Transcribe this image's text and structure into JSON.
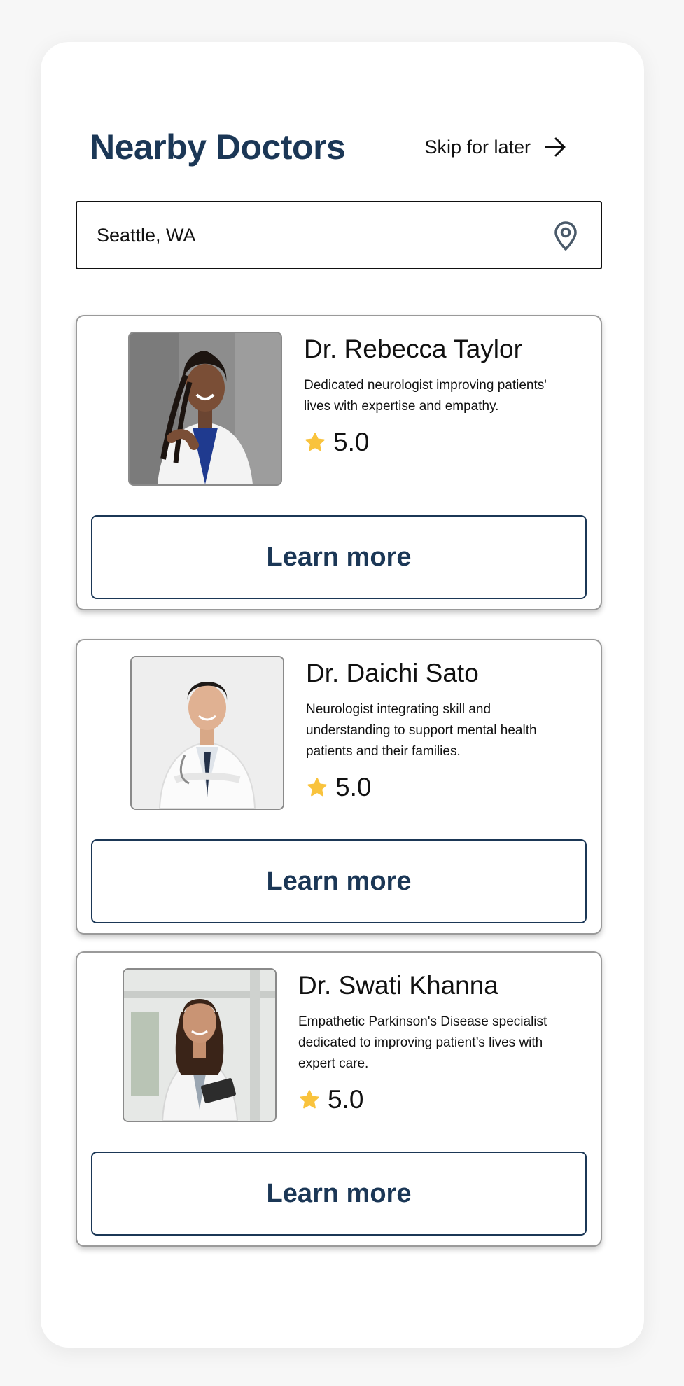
{
  "header": {
    "title": "Nearby Doctors",
    "skip_label": "Skip for later",
    "skip_icon": "arrow-right-icon"
  },
  "search": {
    "value": "Seattle, WA",
    "icon": "location-pin-icon"
  },
  "doctors": [
    {
      "name": "Dr. Rebecca Taylor",
      "description": "Dedicated neurologist improving patients' lives with expertise and empathy.",
      "rating": "5.0",
      "button_label": "Learn more"
    },
    {
      "name": "Dr. Daichi Sato",
      "description": "Neurologist integrating skill and understanding to support mental health patients and their families.",
      "rating": "5.0",
      "button_label": "Learn more"
    },
    {
      "name": "Dr. Swati Khanna",
      "description": "Empathetic Parkinson's Disease specialist dedicated to improving patient’s lives with expert care.",
      "rating": "5.0",
      "button_label": "Learn more"
    }
  ],
  "colors": {
    "brand_navy": "#1b3756",
    "star": "#f9c33d",
    "icon_gray": "#4a5a6a"
  }
}
